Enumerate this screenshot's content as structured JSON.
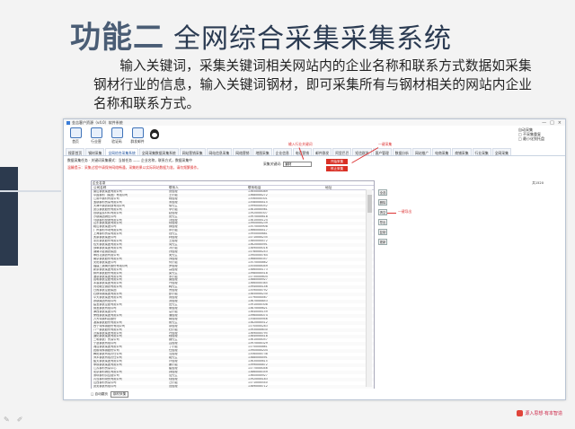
{
  "headline": {
    "strong": "功能二",
    "light": "全网综合采集采集系统"
  },
  "description": "输入关键词，采集关键词相关网站内的企业名称和联系方式数据如采集钢材行业的信息，输入关键词钢材，即可采集所有与钢材相关的网站内企业名称和联系方式。",
  "app": {
    "title": "金吉客户资源（v4.0）软件系统",
    "window_controls": [
      "—",
      "□",
      "×"
    ],
    "toolbar": [
      {
        "icon": "home-icon",
        "label": "首页"
      },
      {
        "icon": "network-icon",
        "label": "行业营"
      },
      {
        "icon": "image-icon",
        "label": "验证码"
      },
      {
        "icon": "mail-icon",
        "label": "群发邮件"
      }
    ],
    "options": [
      "自动采集",
      "□ 不采集重复",
      "□ 最小化到托盘"
    ],
    "tabs": [
      "搜索首页",
      "钢材采集",
      "全网综合采集系统",
      "全网采集数据采集系统",
      "网站营销采集",
      "网站信息采集",
      "网络营销",
      "地图采集",
      "企业信息",
      "电话营销",
      "邮件群发",
      "阿里巴巴",
      "短信群发",
      "客户管理",
      "数据分析",
      "网站推广",
      "电商采集",
      "商铺采集",
      "行业采集",
      "全网采集"
    ],
    "info_line": "数据采集任务 · 关键词采集模式：当前任务 —— 企业名称，联系方式，数据采集中",
    "warning_line": "温馨提示：采集过程中请保持网络畅通，采集结果以实际网站数据为准，请勿频繁操作。",
    "keyword_label": "采集关键词:",
    "keyword_value": "钢材",
    "start_button": "开始采集",
    "stop_button": "停止采集",
    "annotations": {
      "input_hint": "输入行业关键词",
      "one_click_collect": "一键采集",
      "one_click_export": "一键导出"
    },
    "table": {
      "caption": "企业名录",
      "headers": [
        "公司名称",
        "联系人",
        "联系电话",
        "地址"
      ],
      "rows": [
        [
          "唐山钢铁集团有限公司",
          "张经理",
          "1365xxxx089",
          ""
        ],
        [
          "中国钢材（集团）有限公司",
          "王小姐",
          "1368xxxx272",
          ""
        ],
        [
          "江阴市钢材有限公司",
          "杨经理",
          "1356xxxx301",
          ""
        ],
        [
          "宝钢钢材贸易有限公司",
          "宋经理",
          "1358xxxx415",
          ""
        ],
        [
          "天津市钢铁制造有限公司",
          "徐先生",
          "1399xxxx052",
          ""
        ],
        [
          "武汉钢铁股份有限公司",
          "李小姐",
          "1381xxxx561",
          ""
        ],
        [
          "首钢金属材料有限公司",
          "赵经理",
          "1392xxxx307",
          ""
        ],
        [
          "沙钢集团销售公司",
          "张先生",
          "1397xxxx618",
          ""
        ],
        [
          "马钢钢材营销有限公司",
          "刘经理",
          "1381xxxx124",
          ""
        ],
        [
          "山东钢铁集团有限公司",
          "陈经理",
          "1390xxxx239",
          ""
        ],
        [
          "鞍山钢铁集团公司",
          "郝经理",
          "1357xxxx908",
          ""
        ],
        [
          "广州钢材市场有限公司",
          "邓小姐",
          "1366xxxx417",
          ""
        ],
        [
          "上海钢材贸易有限公司",
          "钱先生",
          "1395xxxx681",
          ""
        ],
        [
          "太原钢铁集团公司",
          "林经理",
          "1371xxxx235",
          ""
        ],
        [
          "重庆钢铁股份有限公司",
          "王经理",
          "1380xxxx472",
          ""
        ],
        [
          "包头钢铁集团有限公司",
          "周先生",
          "1362xxxx591",
          ""
        ],
        [
          "邯郸钢铁集团有限公司",
          "冯小姐",
          "1389xxxx016",
          ""
        ],
        [
          "湖南华菱钢铁集团",
          "孙经理",
          "1378xxxx243",
          ""
        ],
        [
          "攀枝花钢铁有限公司",
          "吴先生",
          "1390xxxx764",
          ""
        ],
        [
          "南京钢铁股份有限公司",
          "郑经理",
          "1368xxxx357",
          ""
        ],
        [
          "安阳钢铁集团公司",
          "何小姐",
          "1357xxxx862",
          ""
        ],
        [
          "福建三钢闽光股份有限公司",
          "罗经理",
          "1355xxxx049",
          ""
        ],
        [
          "新余钢铁集团有限公司",
          "高经理",
          "1386xxxx173",
          ""
        ],
        [
          "柳州钢铁股份有限公司",
          "梁先生",
          "1398xxxx518",
          ""
        ],
        [
          "酒泉钢铁集团有限公司",
          "宋小姐",
          "1373xxxx604",
          ""
        ],
        [
          "昆明钢铁控股有限公司",
          "唐经理",
          "1388xxxx927",
          ""
        ],
        [
          "本溪钢铁集团有限公司",
          "许经理",
          "1366xxxx385",
          ""
        ],
        [
          "河北敬业钢铁有限公司",
          "韩先生",
          "1394xxxx146",
          ""
        ],
        [
          "日照钢铁控股集团",
          "曹经理",
          "1359xxxx792",
          ""
        ],
        [
          "石横特钢集团有限公司",
          "彭小姐",
          "1385xxxx230",
          ""
        ],
        [
          "中天钢铁集团有限公司",
          "曾经理",
          "1379xxxx467",
          ""
        ],
        [
          "永钢集团有限公司",
          "萧经理",
          "1367xxxx853",
          ""
        ],
        [
          "建龙钢铁控股有限公司",
          "田先生",
          "1391xxxx308",
          ""
        ],
        [
          "德龙钢铁有限公司",
          "董经理",
          "1387xxxx621",
          ""
        ],
        [
          "津西钢铁集团公司",
          "袁小姐",
          "1364xxxx159",
          ""
        ],
        [
          "荣程钢铁集团有限公司",
          "潘经理",
          "1396xxxx074",
          ""
        ],
        [
          "方大特钢科技股份",
          "蒋经理",
          "1358xxxx946",
          ""
        ],
        [
          "凌源钢铁股份有限公司",
          "蔡先生",
          "1382xxxx512",
          ""
        ],
        [
          "西宁特殊钢股份有限公司",
          "余经理",
          "1370xxxx283",
          ""
        ],
        [
          "八一钢铁股份有限公司",
          "杜小姐",
          "1393xxxx630",
          ""
        ],
        [
          "济源钢铁集团有限公司",
          "叶经理",
          "1369xxxx795",
          ""
        ],
        [
          "通化钢铁集团有限公司",
          "程经理",
          "1384xxxx418",
          ""
        ],
        [
          "三明钢铁厂贸易公司",
          "魏先生",
          "1361xxxx057",
          ""
        ],
        [
          "宁波钢铁有限公司",
          "吕经理",
          "1397xxxx329",
          ""
        ],
        [
          "湘潭钢铁集团有限公司",
          "丁小姐",
          "1375xxxx861",
          ""
        ],
        [
          "抚顺特殊钢股份公司",
          "任经理",
          "1390xxxx204",
          ""
        ],
        [
          "舞阳钢铁有限责任公司",
          "沈经理",
          "1356xxxx738",
          ""
        ],
        [
          "萍乡钢铁有限责任公司",
          "姚先生",
          "1388xxxx491",
          ""
        ],
        [
          "韶关钢铁集团有限公司",
          "卢经理",
          "1363xxxx615",
          ""
        ],
        [
          "承德钢铁集团有限公司",
          "姜小姐",
          "1399xxxx872",
          ""
        ],
        [
          "江苏钢材贸易中心",
          "崔经理",
          "1377xxxx046",
          ""
        ],
        [
          "北京钢材销售有限公司",
          "钟经理",
          "1386xxxx359",
          ""
        ],
        [
          "深圳钢材供应链公司",
          "谭先生",
          "1360xxxx927",
          ""
        ],
        [
          "青岛钢材物资有限公司",
          "陆经理",
          "1392xxxx183",
          ""
        ],
        [
          "山西钢材贸易公司",
          "汪小姐",
          "1371xxxx540",
          ""
        ],
        [
          "武安钢铁有限公司",
          "范经理",
          "1389xxxx712",
          ""
        ]
      ]
    },
    "counter": "共1520",
    "side_buttons": [
      "全选",
      "删除",
      "清空",
      "导出",
      "复制",
      "更新"
    ],
    "status": {
      "label": "□ 自动翻页",
      "select": "钢材采集"
    }
  },
  "footer_logo": "源入思想·有本智造"
}
